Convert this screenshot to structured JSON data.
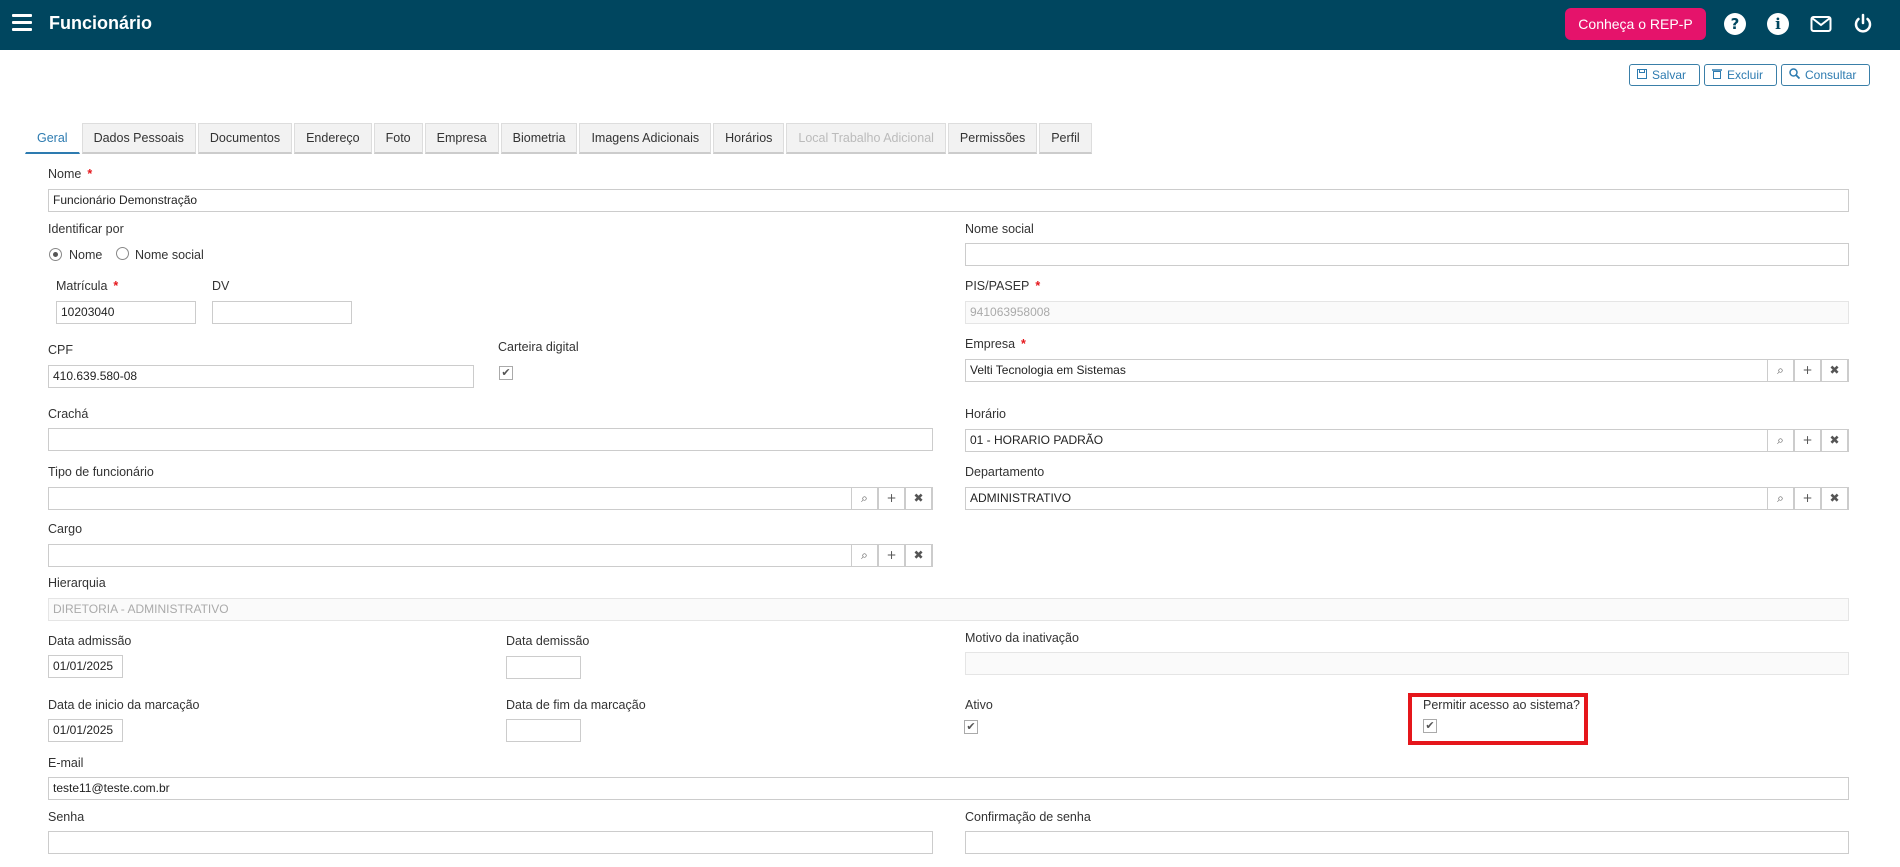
{
  "header": {
    "title": "Funcionário",
    "rep_button": "Conheça o REP-P"
  },
  "actions": {
    "save": "Salvar",
    "delete": "Excluir",
    "search": "Consultar"
  },
  "tabs": [
    "Geral",
    "Dados Pessoais",
    "Documentos",
    "Endereço",
    "Foto",
    "Empresa",
    "Biometria",
    "Imagens Adicionais",
    "Horários",
    "Local Trabalho Adicional",
    "Permissões",
    "Perfil"
  ],
  "form": {
    "nome": {
      "label": "Nome",
      "value": "Funcionário Demonstração"
    },
    "identificar_por": {
      "label": "Identificar por",
      "options": [
        "Nome",
        "Nome social"
      ],
      "selected": "Nome"
    },
    "nome_social": {
      "label": "Nome social",
      "value": ""
    },
    "matricula": {
      "label": "Matrícula",
      "value": "10203040"
    },
    "dv": {
      "label": "DV",
      "value": ""
    },
    "pis": {
      "label": "PIS/PASEP",
      "value": "941063958008"
    },
    "cpf": {
      "label": "CPF",
      "value": "410.639.580-08"
    },
    "carteira": {
      "label": "Carteira digital",
      "checked": true
    },
    "empresa": {
      "label": "Empresa",
      "value": "Velti Tecnologia em Sistemas"
    },
    "cracha": {
      "label": "Crachá",
      "value": ""
    },
    "horario": {
      "label": "Horário",
      "value": "01 - HORARIO PADRÃO"
    },
    "tipo": {
      "label": "Tipo de funcionário",
      "value": ""
    },
    "departamento": {
      "label": "Departamento",
      "value": "ADMINISTRATIVO"
    },
    "cargo": {
      "label": "Cargo",
      "value": ""
    },
    "hierarquia": {
      "label": "Hierarquia",
      "value": "DIRETORIA - ADMINISTRATIVO"
    },
    "data_admissao": {
      "label": "Data admissão",
      "value": "01/01/2025"
    },
    "data_demissao": {
      "label": "Data demissão",
      "value": ""
    },
    "motivo": {
      "label": "Motivo da inativação",
      "value": ""
    },
    "inicio_marcacao": {
      "label": "Data de inicio da marcação",
      "value": "01/01/2025"
    },
    "fim_marcacao": {
      "label": "Data de fim da marcação",
      "value": ""
    },
    "ativo": {
      "label": "Ativo",
      "checked": true
    },
    "permitir": {
      "label": "Permitir acesso ao sistema?",
      "checked": true
    },
    "email": {
      "label": "E-mail",
      "value": "teste11@teste.com.br"
    },
    "senha": {
      "label": "Senha",
      "value": ""
    },
    "confirmacao": {
      "label": "Confirmação de senha",
      "value": ""
    }
  },
  "icons": {
    "menu": "hamburger-icon",
    "help": "question-icon",
    "info": "info-icon",
    "mail": "envelope-icon",
    "power": "power-icon",
    "lookup_search": "search-icon",
    "lookup_add": "plus-icon",
    "lookup_clear": "close-icon"
  },
  "colors": {
    "topbar": "#00465f",
    "rep_button": "#e5136b",
    "accent": "#2d7bb0",
    "required": "#e5161b"
  }
}
